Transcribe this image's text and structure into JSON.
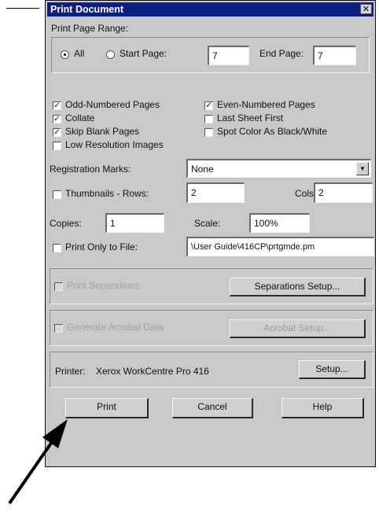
{
  "dialog": {
    "title": "Print Document",
    "close_glyph": "✕"
  },
  "print_range": {
    "label": "Print Page Range:",
    "all_label": "All",
    "start_label": "Start Page:",
    "start_value": "7",
    "end_label": "End Page:",
    "end_value": "7"
  },
  "options": {
    "odd": {
      "label": "Odd-Numbered Pages",
      "checked": true
    },
    "even": {
      "label": "Even-Numbered Pages",
      "checked": true
    },
    "collate": {
      "label": "Collate",
      "checked": true
    },
    "last_sheet": {
      "label": "Last Sheet First",
      "checked": false
    },
    "skip_blank": {
      "label": "Skip Blank Pages",
      "checked": true
    },
    "spot_color": {
      "label": "Spot Color As Black/White",
      "checked": false
    },
    "low_res": {
      "label": "Low Resolution Images",
      "checked": false
    }
  },
  "registration": {
    "label": "Registration Marks:",
    "value": "None",
    "arrow_icon": "▼"
  },
  "thumbnails": {
    "label": "Thumbnails - Rows:",
    "rows_value": "2",
    "cols_label": "Cols:",
    "cols_value": "2"
  },
  "copies": {
    "label": "Copies:",
    "value": "1"
  },
  "scale": {
    "label": "Scale:",
    "value": "100%"
  },
  "print_to_file": {
    "label": "Print Only to File:",
    "value": "\\User Guide\\416CP\\prtgmde.pm"
  },
  "separations": {
    "checkbox_label": "Print Separations",
    "setup_button": "Separations Setup..."
  },
  "acrobat": {
    "checkbox_label": "Generate Acrobat Data",
    "setup_button": "Acrobat Setup..."
  },
  "printer": {
    "label": "Printer:",
    "name": "Xerox WorkCentre Pro 416",
    "setup_button": "Setup..."
  },
  "buttons": {
    "print": "Print",
    "cancel": "Cancel",
    "help": "Help"
  },
  "check_glyph": "✓"
}
